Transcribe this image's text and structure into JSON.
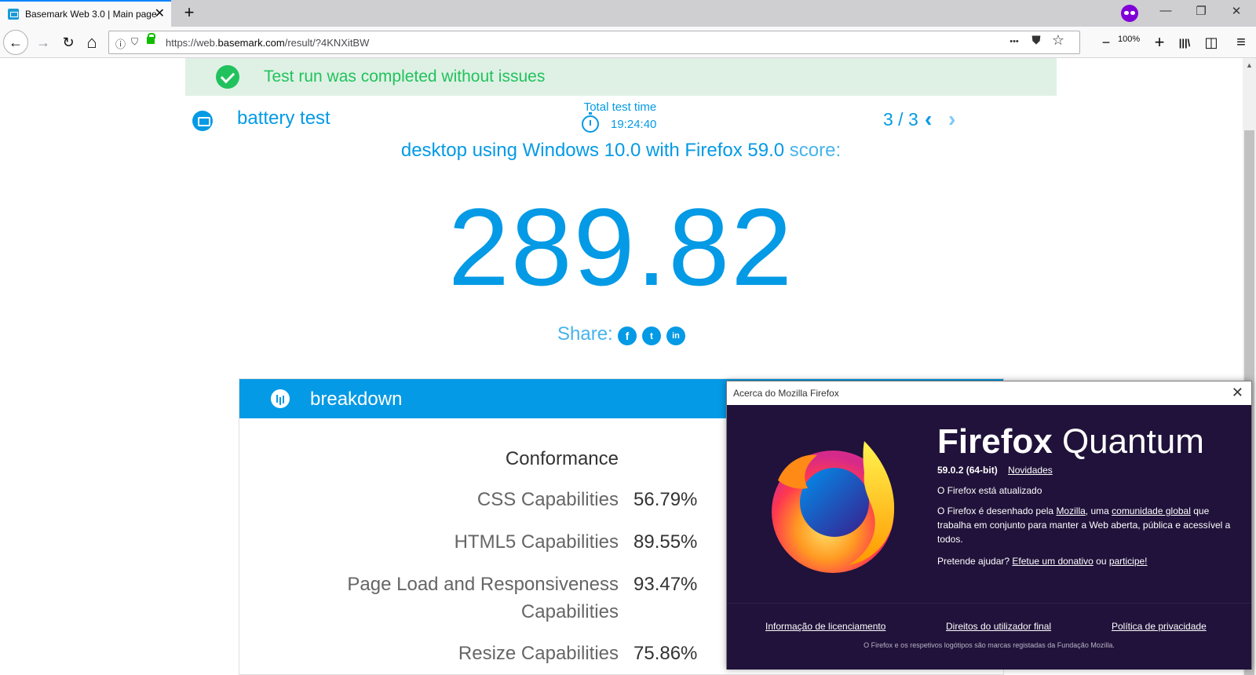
{
  "browser": {
    "tab_title": "Basemark Web 3.0 | Main page",
    "tab_close": "✕",
    "new_tab": "+",
    "url_prefix": "https://web.",
    "url_domain": "basemark.com",
    "url_path": "/result/?4KNXitBW",
    "zoom": "100%",
    "window_min": "—",
    "window_restore": "❐",
    "window_close": "✕",
    "icons": {
      "back": "back-arrow-icon",
      "forward": "forward-arrow-icon",
      "reload": "reload-icon",
      "home": "home-icon",
      "info": "info-icon",
      "tracking": "tracking-shield-icon",
      "lock": "lock-icon",
      "page_actions": "more-icon",
      "pocket": "pocket-icon",
      "bookmark": "star-icon",
      "zoom_out": "minus-icon",
      "zoom_in": "plus-icon",
      "library": "library-icon",
      "sidebar": "sidebar-icon",
      "menu": "hamburger-icon",
      "private": "private-browsing-icon"
    },
    "glyphs": {
      "back": "←",
      "forward": "→",
      "reload": "↻",
      "home": "⌂",
      "info": "ⓘ",
      "tracking": "⛉",
      "page_actions": "•••",
      "pocket": "⛊",
      "bookmark": "☆",
      "zoom_out": "−",
      "zoom_in": "+",
      "library": "|||\\",
      "sidebar": "◫",
      "menu": "≡"
    }
  },
  "page": {
    "banner_text": "Test run was completed without issues",
    "test_name": "battery test",
    "total_time_label": "Total test time",
    "total_time_value": "19:24:40",
    "pager": "3 / 3",
    "pager_prev": "‹",
    "pager_next": "›",
    "subtitle_main": "desktop using Windows 10.0 with Firefox 59.0",
    "subtitle_suffix": " score:",
    "score": "289.82",
    "share_label": "Share:",
    "social": {
      "facebook": "f",
      "twitter": "t",
      "linkedin": "in"
    },
    "breakdown_title": "breakdown",
    "breakdown_heading": "Conformance",
    "breakdown_rows": [
      {
        "label": "CSS Capabilities",
        "value": "56.79%"
      },
      {
        "label": "HTML5 Capabilities",
        "value": "89.55%"
      },
      {
        "label": "Page Load and Responsiveness",
        "label2": "Capabilities",
        "value": "93.47%"
      },
      {
        "label": "Resize Capabilities",
        "value": "75.86%"
      }
    ],
    "colors": {
      "accent": "#049ae5",
      "success": "#21c25e",
      "banner_bg": "#dff1e4"
    }
  },
  "dialog": {
    "title": "Acerca do Mozilla Firefox",
    "close": "✕",
    "product_bold": "Firefox",
    "product_light": "Quantum",
    "version": "59.0.2 (64-bit)",
    "whats_new": "Novidades",
    "status": "O Firefox está atualizado",
    "desc_1": "O Firefox é desenhado pela ",
    "desc_mozilla": "Mozilla",
    "desc_2": ", uma ",
    "desc_community": "comunidade global",
    "desc_3": " que trabalha em conjunto para manter a Web aberta, pública e acessível a todos.",
    "help_prefix": "Pretende ajudar? ",
    "donate": "Efetue um donativo",
    "help_or": " ou ",
    "participate": "participe!",
    "footer_licensing": "Informação de licenciamento",
    "footer_rights": "Direitos do utilizador final",
    "footer_privacy": "Política de privacidade",
    "trademark": "O Firefox e os respetivos logótipos são marcas registadas da Fundação Mozilla.",
    "colors": {
      "background": "#20123a"
    }
  }
}
